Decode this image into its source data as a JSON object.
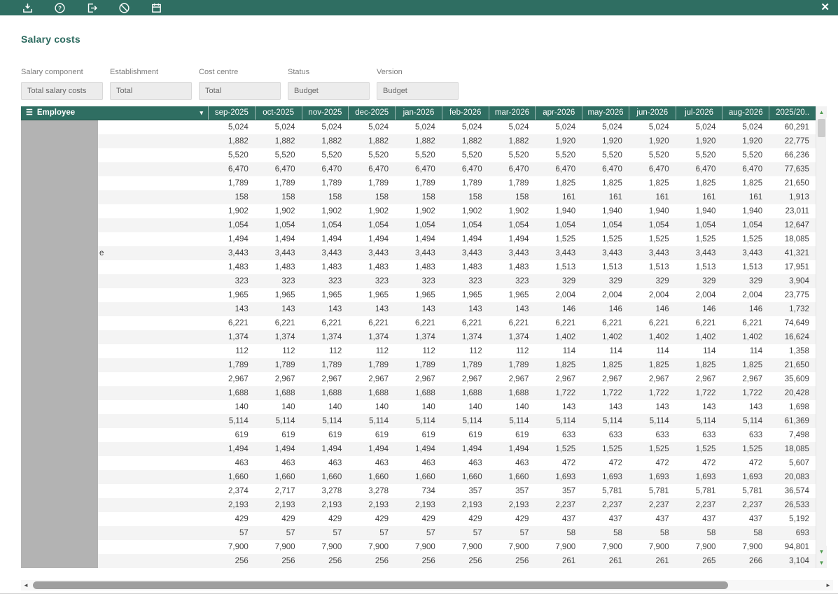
{
  "window": {
    "title": "Salary costs",
    "close_glyph": "✕"
  },
  "toolbar": {
    "icons": [
      "save-icon",
      "help-icon",
      "export-icon",
      "cancel-icon",
      "calendar-icon"
    ]
  },
  "filters": [
    {
      "label": "Salary component",
      "value": "Total salary costs"
    },
    {
      "label": "Establishment",
      "value": "Total"
    },
    {
      "label": "Cost centre",
      "value": "Total"
    },
    {
      "label": "Status",
      "value": "Budget"
    },
    {
      "label": "Version",
      "value": "Budget"
    }
  ],
  "table": {
    "employee_header": "Employee",
    "menu_glyph": "☰",
    "dropdown_glyph": "▾",
    "month_headers": [
      "sep-2025",
      "oct-2025",
      "nov-2025",
      "dec-2025",
      "jan-2026",
      "feb-2026",
      "mar-2026",
      "apr-2026",
      "may-2026",
      "jun-2026",
      "jul-2026",
      "aug-2026",
      "2025/20.."
    ],
    "employee_fragment": {
      "row": 10,
      "text": "e"
    },
    "rows": [
      [
        "5,024",
        "5,024",
        "5,024",
        "5,024",
        "5,024",
        "5,024",
        "5,024",
        "5,024",
        "5,024",
        "5,024",
        "5,024",
        "5,024",
        "60,291"
      ],
      [
        "1,882",
        "1,882",
        "1,882",
        "1,882",
        "1,882",
        "1,882",
        "1,882",
        "1,920",
        "1,920",
        "1,920",
        "1,920",
        "1,920",
        "22,775"
      ],
      [
        "5,520",
        "5,520",
        "5,520",
        "5,520",
        "5,520",
        "5,520",
        "5,520",
        "5,520",
        "5,520",
        "5,520",
        "5,520",
        "5,520",
        "66,236"
      ],
      [
        "6,470",
        "6,470",
        "6,470",
        "6,470",
        "6,470",
        "6,470",
        "6,470",
        "6,470",
        "6,470",
        "6,470",
        "6,470",
        "6,470",
        "77,635"
      ],
      [
        "1,789",
        "1,789",
        "1,789",
        "1,789",
        "1,789",
        "1,789",
        "1,789",
        "1,825",
        "1,825",
        "1,825",
        "1,825",
        "1,825",
        "21,650"
      ],
      [
        "158",
        "158",
        "158",
        "158",
        "158",
        "158",
        "158",
        "161",
        "161",
        "161",
        "161",
        "161",
        "1,913"
      ],
      [
        "1,902",
        "1,902",
        "1,902",
        "1,902",
        "1,902",
        "1,902",
        "1,902",
        "1,940",
        "1,940",
        "1,940",
        "1,940",
        "1,940",
        "23,011"
      ],
      [
        "1,054",
        "1,054",
        "1,054",
        "1,054",
        "1,054",
        "1,054",
        "1,054",
        "1,054",
        "1,054",
        "1,054",
        "1,054",
        "1,054",
        "12,647"
      ],
      [
        "1,494",
        "1,494",
        "1,494",
        "1,494",
        "1,494",
        "1,494",
        "1,494",
        "1,525",
        "1,525",
        "1,525",
        "1,525",
        "1,525",
        "18,085"
      ],
      [
        "3,443",
        "3,443",
        "3,443",
        "3,443",
        "3,443",
        "3,443",
        "3,443",
        "3,443",
        "3,443",
        "3,443",
        "3,443",
        "3,443",
        "41,321"
      ],
      [
        "1,483",
        "1,483",
        "1,483",
        "1,483",
        "1,483",
        "1,483",
        "1,483",
        "1,513",
        "1,513",
        "1,513",
        "1,513",
        "1,513",
        "17,951"
      ],
      [
        "323",
        "323",
        "323",
        "323",
        "323",
        "323",
        "323",
        "329",
        "329",
        "329",
        "329",
        "329",
        "3,904"
      ],
      [
        "1,965",
        "1,965",
        "1,965",
        "1,965",
        "1,965",
        "1,965",
        "1,965",
        "2,004",
        "2,004",
        "2,004",
        "2,004",
        "2,004",
        "23,775"
      ],
      [
        "143",
        "143",
        "143",
        "143",
        "143",
        "143",
        "143",
        "146",
        "146",
        "146",
        "146",
        "146",
        "1,732"
      ],
      [
        "6,221",
        "6,221",
        "6,221",
        "6,221",
        "6,221",
        "6,221",
        "6,221",
        "6,221",
        "6,221",
        "6,221",
        "6,221",
        "6,221",
        "74,649"
      ],
      [
        "1,374",
        "1,374",
        "1,374",
        "1,374",
        "1,374",
        "1,374",
        "1,374",
        "1,402",
        "1,402",
        "1,402",
        "1,402",
        "1,402",
        "16,624"
      ],
      [
        "112",
        "112",
        "112",
        "112",
        "112",
        "112",
        "112",
        "114",
        "114",
        "114",
        "114",
        "114",
        "1,358"
      ],
      [
        "1,789",
        "1,789",
        "1,789",
        "1,789",
        "1,789",
        "1,789",
        "1,789",
        "1,825",
        "1,825",
        "1,825",
        "1,825",
        "1,825",
        "21,650"
      ],
      [
        "2,967",
        "2,967",
        "2,967",
        "2,967",
        "2,967",
        "2,967",
        "2,967",
        "2,967",
        "2,967",
        "2,967",
        "2,967",
        "2,967",
        "35,609"
      ],
      [
        "1,688",
        "1,688",
        "1,688",
        "1,688",
        "1,688",
        "1,688",
        "1,688",
        "1,722",
        "1,722",
        "1,722",
        "1,722",
        "1,722",
        "20,428"
      ],
      [
        "140",
        "140",
        "140",
        "140",
        "140",
        "140",
        "140",
        "143",
        "143",
        "143",
        "143",
        "143",
        "1,698"
      ],
      [
        "5,114",
        "5,114",
        "5,114",
        "5,114",
        "5,114",
        "5,114",
        "5,114",
        "5,114",
        "5,114",
        "5,114",
        "5,114",
        "5,114",
        "61,369"
      ],
      [
        "619",
        "619",
        "619",
        "619",
        "619",
        "619",
        "619",
        "633",
        "633",
        "633",
        "633",
        "633",
        "7,498"
      ],
      [
        "1,494",
        "1,494",
        "1,494",
        "1,494",
        "1,494",
        "1,494",
        "1,494",
        "1,525",
        "1,525",
        "1,525",
        "1,525",
        "1,525",
        "18,085"
      ],
      [
        "463",
        "463",
        "463",
        "463",
        "463",
        "463",
        "463",
        "472",
        "472",
        "472",
        "472",
        "472",
        "5,607"
      ],
      [
        "1,660",
        "1,660",
        "1,660",
        "1,660",
        "1,660",
        "1,660",
        "1,660",
        "1,693",
        "1,693",
        "1,693",
        "1,693",
        "1,693",
        "20,083"
      ],
      [
        "2,374",
        "2,717",
        "3,278",
        "3,278",
        "734",
        "357",
        "357",
        "357",
        "5,781",
        "5,781",
        "5,781",
        "5,781",
        "36,574"
      ],
      [
        "2,193",
        "2,193",
        "2,193",
        "2,193",
        "2,193",
        "2,193",
        "2,193",
        "2,237",
        "2,237",
        "2,237",
        "2,237",
        "2,237",
        "26,533"
      ],
      [
        "429",
        "429",
        "429",
        "429",
        "429",
        "429",
        "429",
        "437",
        "437",
        "437",
        "437",
        "437",
        "5,192"
      ],
      [
        "57",
        "57",
        "57",
        "57",
        "57",
        "57",
        "57",
        "58",
        "58",
        "58",
        "58",
        "58",
        "693"
      ],
      [
        "7,900",
        "7,900",
        "7,900",
        "7,900",
        "7,900",
        "7,900",
        "7,900",
        "7,900",
        "7,900",
        "7,900",
        "7,900",
        "7,900",
        "94,801"
      ],
      [
        "256",
        "256",
        "256",
        "256",
        "256",
        "256",
        "256",
        "261",
        "261",
        "261",
        "265",
        "266",
        "3,104"
      ]
    ]
  },
  "scrollbars": {
    "up": "▲",
    "down": "▼",
    "left": "◄",
    "right": "►"
  },
  "colors": {
    "accent": "#2f6e62",
    "redaction_gray": "#b3b3b3",
    "scroll_arrow_green": "#4e9b4e"
  }
}
